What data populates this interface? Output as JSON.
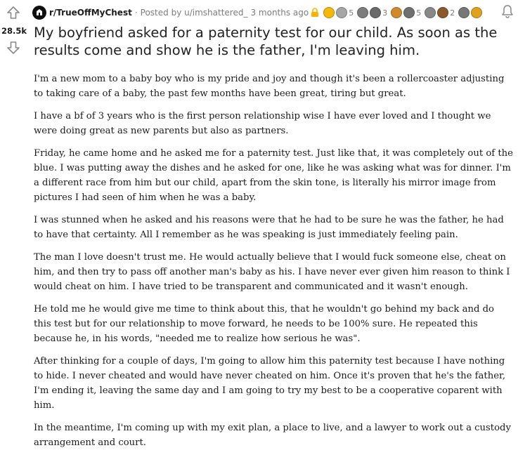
{
  "post": {
    "subreddit": "r/TrueOffMyChest",
    "posted_by": "Posted by u/imshattered_",
    "time": "3 months ago",
    "score": "28.5k",
    "title": "My boyfriend asked for a paternity test for our child. As soon as the results come and show he is the father, I'm leaving him.",
    "awards": [
      {
        "icon": "award-gold-icon",
        "color": "#f5b70b"
      },
      {
        "icon": "award-silver-icon",
        "color": "#a6a6a6",
        "count": "5"
      },
      {
        "icon": "award-f-icon",
        "color": "#7d7d7d"
      },
      {
        "icon": "award-hug-icon",
        "color": "#6a6a6a",
        "count": "3"
      },
      {
        "icon": "award-bear-icon",
        "color": "#d08a2c"
      },
      {
        "icon": "award-dollar-icon",
        "color": "#707070",
        "count": "5"
      },
      {
        "icon": "award-cat-icon",
        "color": "#888888"
      },
      {
        "icon": "award-trophy-icon",
        "color": "#8b5a2b",
        "count": "2"
      },
      {
        "icon": "award-hands-icon",
        "color": "#777777"
      },
      {
        "icon": "award-wholesome-icon",
        "color": "#e0a020"
      }
    ],
    "paragraphs": [
      "I'm a new mom to a baby boy who is my pride and joy and though it's been a rollercoaster adjusting to taking care of a baby, the past few months have been great, tiring but great.",
      "I have a bf of 3 years who is the first person relationship wise I have ever loved and I thought we were doing great as new parents but also as partners.",
      "Friday, he came home and he asked me for a paternity test. Just like that, it was completely out of the blue. I was putting away the dishes and he asked for one, like he was asking what was for dinner. I'm a different race from him but our child, apart from the skin tone, is literally his mirror image from pictures I had seen of him when he was a baby.",
      "I was stunned when he asked and his reasons were that he had to be sure he was the father, he had to have that certainty. All I remember as he was speaking is just immediately feeling pain.",
      "The man I love doesn't trust me. He would actually believe that I would fuck someone else, cheat on him, and then try to pass off another man's baby as his. I have never ever given him reason to think I would cheat on him. I have tried to be transparent and communicated and it wasn't enough.",
      "He told me he would give me time to think about this, that he wouldn't go behind my back and do this test but for our relationship to move forward, he needs to be 100% sure. He repeated this because he, in his words, \"needed me to realize how serious he was\".",
      "After thinking for a couple of days, I'm going to allow him this paternity test because I have nothing to hide. I never cheated and would have never cheated on him. Once it's proven that he's the father, I'm ending it, leaving the same day and I am going to try my best to be a cooperative coparent with him.",
      "In the meantime, I'm coming up with my exit plan, a place to live, and a lawyer to work out a custody arrangement and court."
    ]
  },
  "colors": {
    "lock": "#ffb000",
    "text": "#1c1c1c",
    "meta": "#7c7c7c"
  }
}
